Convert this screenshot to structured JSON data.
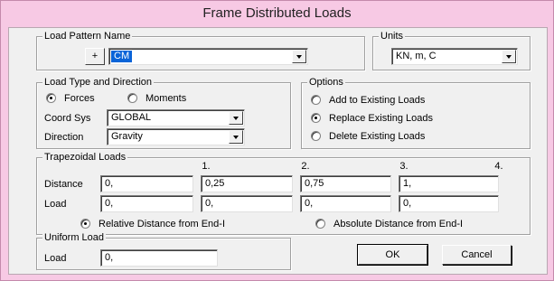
{
  "window": {
    "title": "Frame Distributed Loads"
  },
  "load_pattern": {
    "legend": "Load Pattern Name",
    "add_button": "+",
    "value": "CM"
  },
  "units": {
    "legend": "Units",
    "value": "KN, m, C"
  },
  "load_type": {
    "legend": "Load Type and Direction",
    "forces": "Forces",
    "moments": "Moments",
    "selected": "Forces",
    "coord_sys_label": "Coord Sys",
    "coord_sys_value": "GLOBAL",
    "direction_label": "Direction",
    "direction_value": "Gravity"
  },
  "options": {
    "legend": "Options",
    "add": "Add to Existing Loads",
    "replace": "Replace Existing Loads",
    "delete": "Delete Existing Loads",
    "selected": "Replace Existing Loads"
  },
  "trapezoidal": {
    "legend": "Trapezoidal Loads",
    "columns": [
      "1.",
      "2.",
      "3.",
      "4."
    ],
    "distance_label": "Distance",
    "load_label": "Load",
    "distances": [
      "0,",
      "0,25",
      "0,75",
      "1,"
    ],
    "loads": [
      "0,",
      "0,",
      "0,",
      "0,"
    ],
    "relative": "Relative Distance from End-I",
    "absolute": "Absolute Distance from End-I",
    "selected": "Relative Distance from End-I"
  },
  "uniform": {
    "legend": "Uniform Load",
    "load_label": "Load",
    "value": "0,"
  },
  "buttons": {
    "ok": "OK",
    "cancel": "Cancel"
  },
  "colors": {
    "title_bar": "#f7c9e4",
    "dialog_bg": "#f0f0f0",
    "selection": "#0a64d8"
  }
}
